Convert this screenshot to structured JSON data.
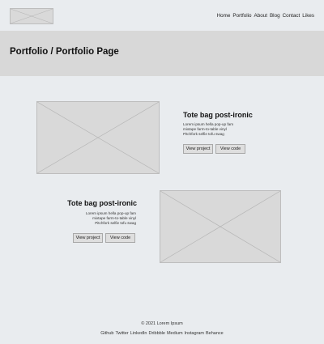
{
  "header": {
    "nav": [
      "Home",
      "Portfolio",
      "About",
      "Blog",
      "Contact",
      "Likes"
    ]
  },
  "banner": {
    "title": "Portfolio / Portfolio Page"
  },
  "projects": [
    {
      "title": "Tote bag post-ironic",
      "desc": [
        "Lorem ipsum hella pop-up fam",
        "mixtape farm-to-table vinyl",
        "Pitchfork selfie tofu swag"
      ],
      "buttons": [
        "View project",
        "View code"
      ]
    },
    {
      "title": "Tote bag post-ironic",
      "desc": [
        "Lorem ipsum hella pop-up fam",
        "mixtape farm-to-table vinyl",
        "Pitchfork selfie tofu swag"
      ],
      "buttons": [
        "View project",
        "View code"
      ]
    }
  ],
  "footer": {
    "copyright": "© 2021 Lorem Ipsum",
    "links": [
      "Github",
      "Twitter",
      "LinkedIn",
      "Dribbble",
      "Medium",
      "Instagram",
      "Behance"
    ]
  }
}
